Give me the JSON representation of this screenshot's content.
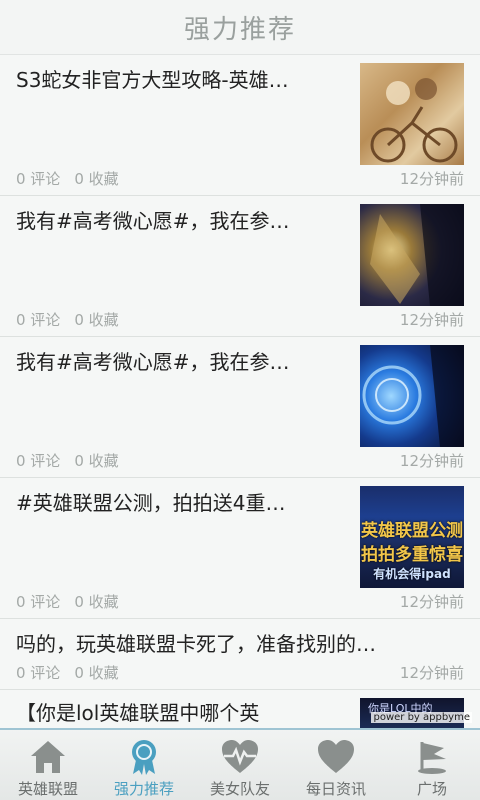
{
  "header": {
    "title": "强力推荐"
  },
  "items": [
    {
      "text": "S3蛇女非官方大型攻略-英雄…",
      "comments": "0 评论",
      "favorites": "0 收藏",
      "time": "12分钟前"
    },
    {
      "text": "我有#高考微心愿#，我在参…",
      "comments": "0 评论",
      "favorites": "0 收藏",
      "time": "12分钟前"
    },
    {
      "text": "我有#高考微心愿#，我在参…",
      "comments": "0 评论",
      "favorites": "0 收藏",
      "time": "12分钟前"
    },
    {
      "text": "#英雄联盟公测，拍拍送4重…",
      "comments": "0 评论",
      "favorites": "0 收藏",
      "time": "12分钟前",
      "thumb_line1": "英雄联盟公测",
      "thumb_line2": "拍拍多重惊喜",
      "thumb_line3": "有机会得ipad"
    },
    {
      "text": "吗的，玩英雄联盟卡死了，准备找别的…",
      "comments": "0 评论",
      "favorites": "0 收藏",
      "time": "12分钟前"
    },
    {
      "text": "【你是lol英雄联盟中哪个英",
      "thumb_text": "你是LOL中的"
    }
  ],
  "powered_by": "power by appbyme",
  "tabs": [
    {
      "label": "英雄联盟",
      "icon": "house-icon",
      "active": false
    },
    {
      "label": "强力推荐",
      "icon": "medal-icon",
      "active": true
    },
    {
      "label": "美女队友",
      "icon": "heartbeat-icon",
      "active": false
    },
    {
      "label": "每日资讯",
      "icon": "heart-icon",
      "active": false
    },
    {
      "label": "广场",
      "icon": "flag-icon",
      "active": false
    }
  ],
  "colors": {
    "accent": "#4a9fc0",
    "inactive": "#6b6f6e",
    "meta": "#a4a9a7"
  }
}
